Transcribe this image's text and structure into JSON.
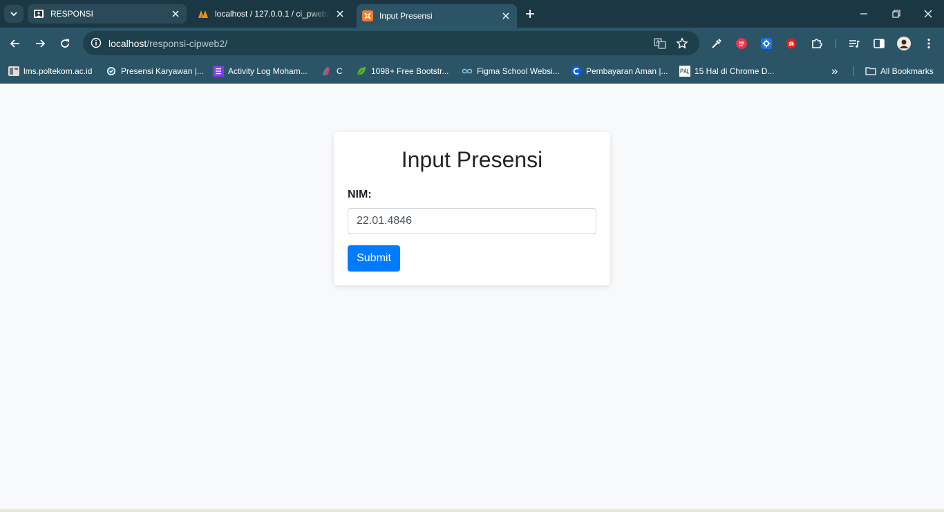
{
  "browser": {
    "tabs": [
      {
        "title": "RESPONSI",
        "icon": "classroom-icon"
      },
      {
        "title": "localhost / 127.0.0.1 / ci_pweb2",
        "icon": "phpmyadmin-icon"
      },
      {
        "title": "Input Presensi",
        "icon": "xampp-icon",
        "active": true
      }
    ],
    "url": {
      "host": "localhost",
      "path": "/responsi-cipweb2/"
    },
    "bookmarks": [
      {
        "label": "lms.poltekom.ac.id",
        "icon": "lms-icon"
      },
      {
        "label": "Presensi Karyawan |...",
        "icon": "check-badge-icon"
      },
      {
        "label": "Activity Log Moham...",
        "icon": "list-icon"
      },
      {
        "label": "C",
        "icon": "colorful-bird-icon"
      },
      {
        "label": "1098+ Free Bootstr...",
        "icon": "leaf-icon"
      },
      {
        "label": "Figma School Websi...",
        "icon": "infinity-icon"
      },
      {
        "label": "Pembayaran Aman |...",
        "icon": "c-logo-icon"
      },
      {
        "label": "15 Hal di Chrome D...",
        "icon": "pal-icon"
      }
    ],
    "bookmarks_overflow": "»",
    "all_bookmarks_label": "All Bookmarks",
    "colors": {
      "tabstrip": "#1c3744",
      "toolbar": "#2b5566",
      "omnibox": "#1e3f4c"
    }
  },
  "page": {
    "heading": "Input Presensi",
    "nim_label": "NIM:",
    "nim_value": "22.01.4846",
    "submit_label": "Submit",
    "colors": {
      "background": "#f8f9fa",
      "button": "#007bff"
    }
  }
}
